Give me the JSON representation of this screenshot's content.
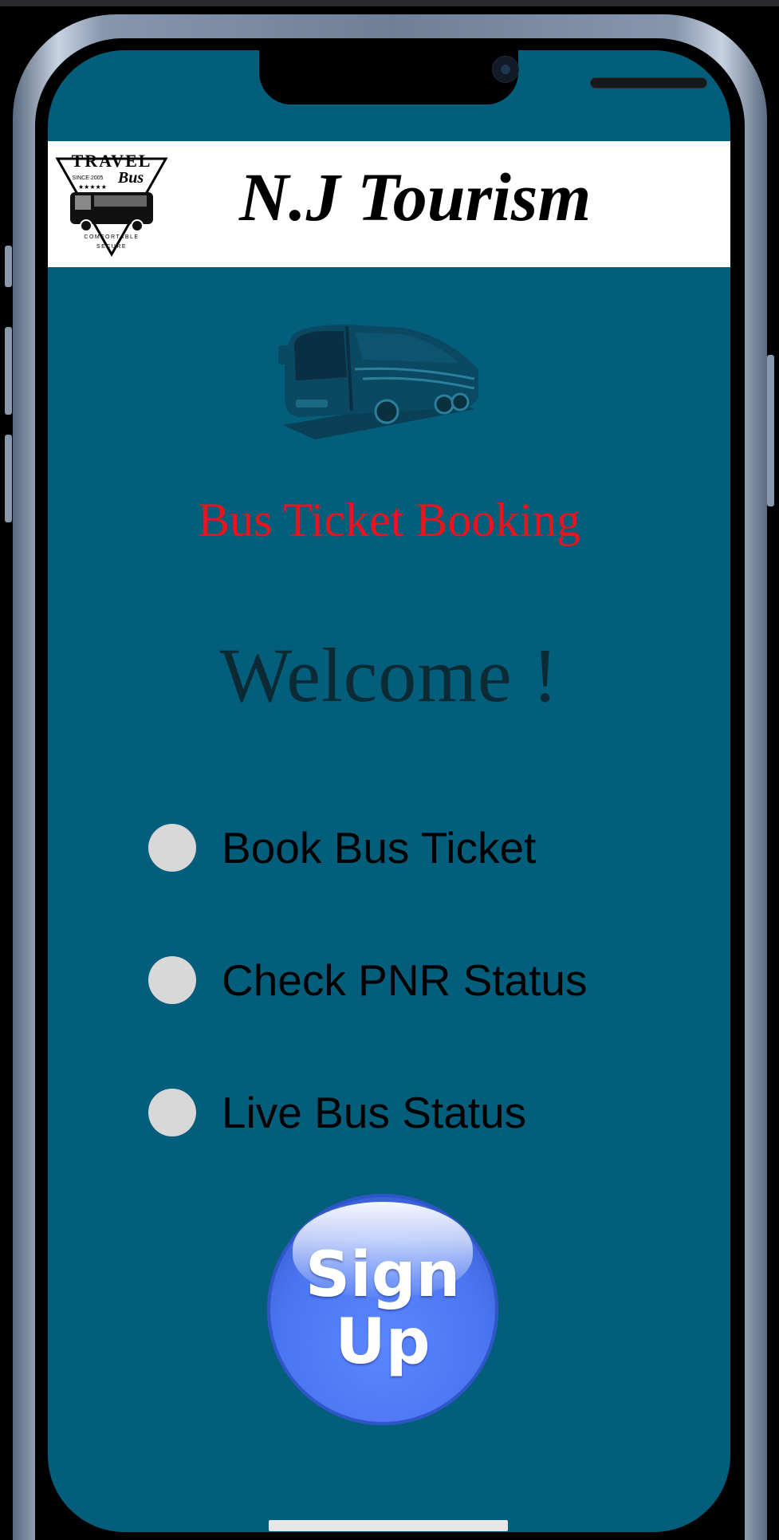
{
  "header": {
    "brand_title": "N.J Tourism",
    "logo": {
      "text_top": "TRAVEL",
      "text_script": "Bus",
      "since": "SINCE 2005",
      "bottom_1": "COMFORTABLE",
      "bottom_2": "SECURE"
    }
  },
  "hero": {
    "icon": "bus-icon",
    "subtitle": "Bus Ticket Booking"
  },
  "welcome": "Welcome !",
  "options": [
    {
      "label": "Book Bus Ticket"
    },
    {
      "label": "Check PNR Status"
    },
    {
      "label": "Live Bus Status"
    }
  ],
  "signup": {
    "line1": "Sign",
    "line2": "Up"
  },
  "colors": {
    "screen_bg": "#025e7a",
    "accent_red": "#e8141e",
    "button_blue": "#4b76f1",
    "radio": "#d8d8d8"
  }
}
